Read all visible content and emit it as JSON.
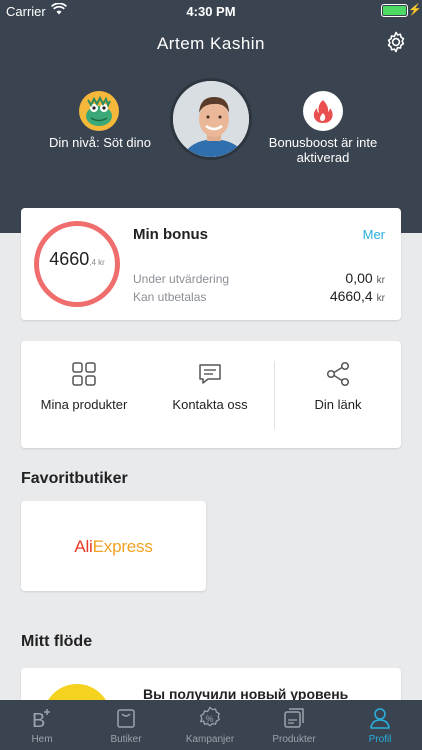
{
  "status_bar": {
    "carrier": "Carrier",
    "time": "4:30 PM"
  },
  "profile": {
    "name": "Artem Kashin",
    "level_label": "Din nivå: Söt dino",
    "boost_label": "Bonusboost är inte aktiverad"
  },
  "bonus": {
    "total_main": "4660",
    "total_fraction": ",4 kr",
    "title": "Min bonus",
    "more": "Mer",
    "rows": [
      {
        "label": "Under utvärdering",
        "value": "0,00",
        "unit": "kr"
      },
      {
        "label": "Kan utbetalas",
        "value": "4660,4",
        "unit": "kr"
      }
    ]
  },
  "actions": [
    {
      "label": "Mina produkter",
      "icon": "grid-icon"
    },
    {
      "label": "Kontakta oss",
      "icon": "chat-icon"
    },
    {
      "label": "Din länk",
      "icon": "share-icon"
    }
  ],
  "favorites": {
    "title": "Favoritbutiker",
    "store_name_a": "Ali",
    "store_name_b": "Express"
  },
  "feed": {
    "title": "Mitt flöde",
    "item_text": "Вы получили новый уровень"
  },
  "tabs": [
    {
      "label": "Hem",
      "icon": "home-b-icon",
      "active": false
    },
    {
      "label": "Butiker",
      "icon": "bag-icon",
      "active": false
    },
    {
      "label": "Kampanjer",
      "icon": "percent-badge-icon",
      "active": false
    },
    {
      "label": "Produkter",
      "icon": "products-icon",
      "active": false
    },
    {
      "label": "Profil",
      "icon": "person-icon",
      "active": true
    }
  ],
  "colors": {
    "header_bg": "#3a4450",
    "accent": "#2aaedc",
    "ring": "#ef6d6d",
    "boost_flame": "#ea4f4f",
    "level_badge": "#f5b83a"
  }
}
